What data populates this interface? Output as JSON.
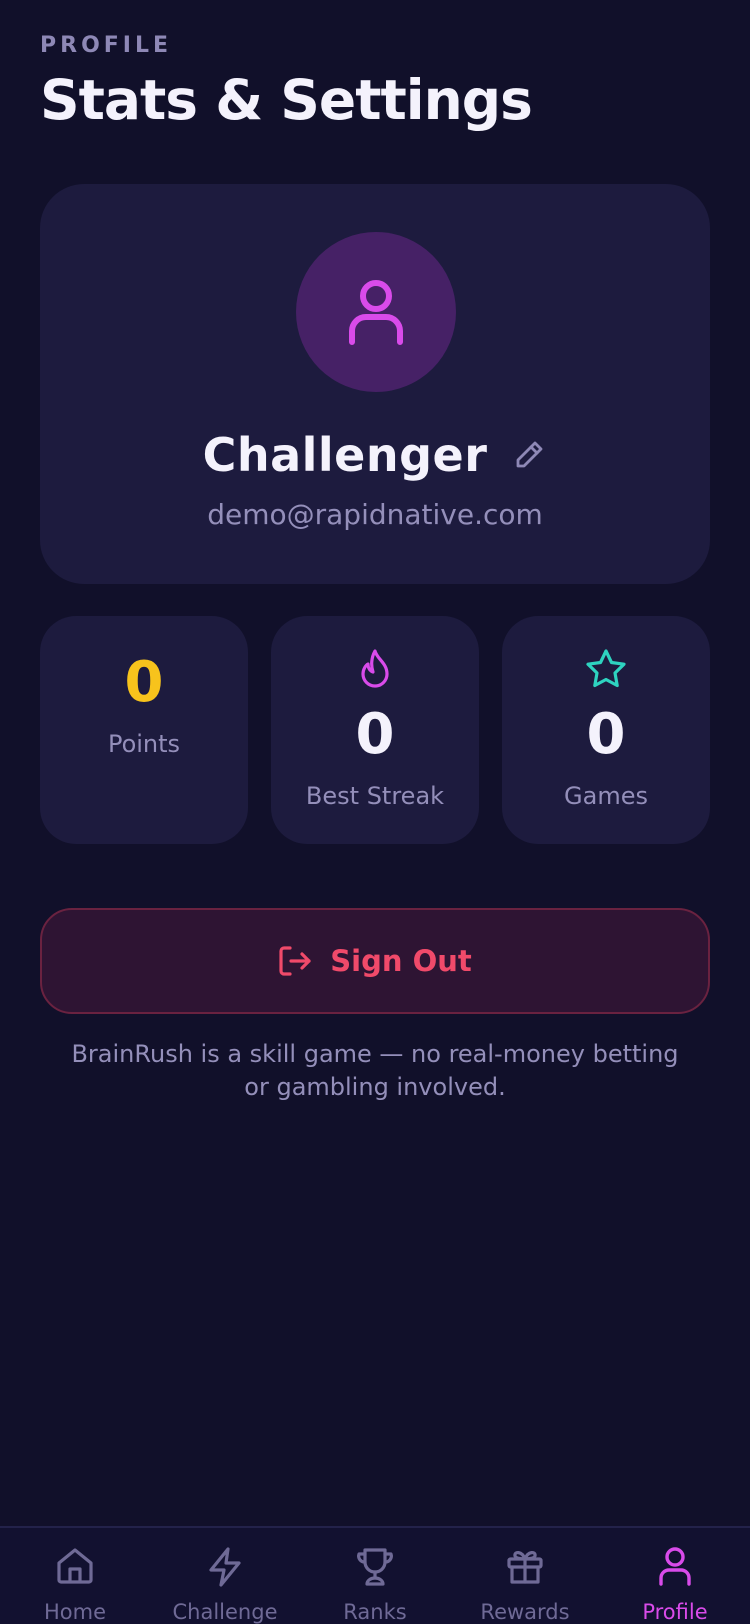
{
  "header": {
    "eyebrow": "PROFILE",
    "title": "Stats & Settings"
  },
  "profile": {
    "avatar_icon": "user-icon",
    "name": "Challenger",
    "edit_icon": "pencil-icon",
    "email": "demo@rapidnative.com"
  },
  "stats": [
    {
      "value": "0",
      "label": "Points",
      "icon": "",
      "color": "#f7c31c"
    },
    {
      "value": "0",
      "label": "Best Streak",
      "icon": "flame-icon",
      "color": "#d94bea"
    },
    {
      "value": "0",
      "label": "Games",
      "icon": "star-icon",
      "color": "#2ed3c0"
    }
  ],
  "signout": {
    "label": "Sign Out",
    "icon": "log-out-icon",
    "color": "#f04a6a"
  },
  "disclaimer": "BrainRush is a skill game — no real-money betting or gambling involved.",
  "tabs": [
    {
      "label": "Home",
      "icon": "home-icon",
      "active": false
    },
    {
      "label": "Challenge",
      "icon": "lightning-icon",
      "active": false
    },
    {
      "label": "Ranks",
      "icon": "trophy-icon",
      "active": false
    },
    {
      "label": "Rewards",
      "icon": "gift-icon",
      "active": false
    },
    {
      "label": "Profile",
      "icon": "user-icon",
      "active": true
    }
  ],
  "colors": {
    "background": "#11102a",
    "card": "#1d1b3e",
    "accent": "#d94bea",
    "muted": "#948fba"
  }
}
